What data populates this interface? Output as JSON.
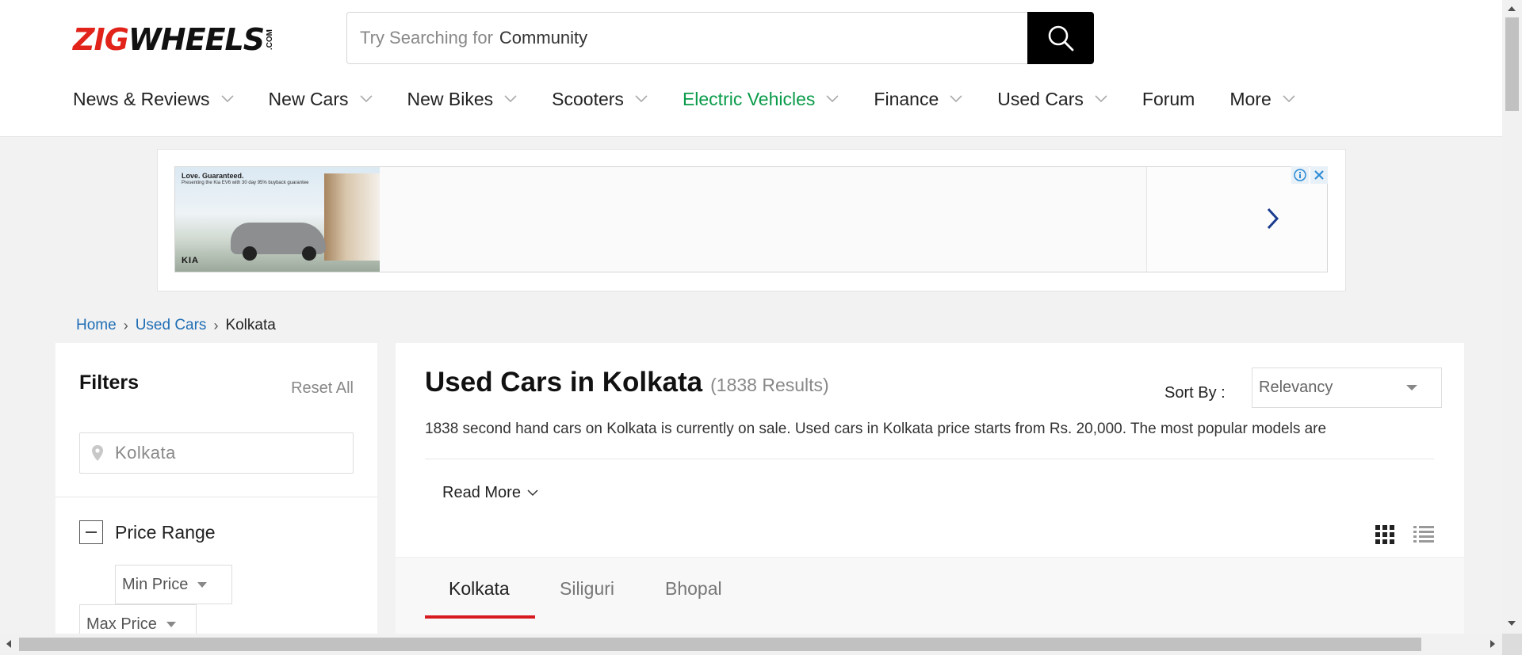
{
  "brand": {
    "logo_part1": "ZIG",
    "logo_part2": "WHEELS",
    "logo_suffix": ".COM",
    "logo_red": "#e2231a"
  },
  "search": {
    "placeholder": "Try Searching for",
    "value": "Community",
    "icon": "search-icon"
  },
  "nav": {
    "items": [
      {
        "label": "News & Reviews",
        "dropdown": true
      },
      {
        "label": "New Cars",
        "dropdown": true
      },
      {
        "label": "New Bikes",
        "dropdown": true
      },
      {
        "label": "Scooters",
        "dropdown": true
      },
      {
        "label": "Electric Vehicles",
        "dropdown": true,
        "color": "#0a9b4a"
      },
      {
        "label": "Finance",
        "dropdown": true
      },
      {
        "label": "Used Cars",
        "dropdown": true
      },
      {
        "label": "Forum",
        "dropdown": false
      },
      {
        "label": "More",
        "dropdown": true
      }
    ]
  },
  "ad": {
    "tagline": "Love. Guaranteed.",
    "subline": "Presenting the Kia EV6 with 30 day 95% buyback guarantee",
    "brand": "KIA",
    "icons": [
      "info-icon",
      "close-icon"
    ]
  },
  "breadcrumb": {
    "items": [
      "Home",
      "Used Cars"
    ],
    "current": "Kolkata"
  },
  "filters": {
    "title": "Filters",
    "reset_label": "Reset All",
    "city_value": "Kolkata",
    "price_range": {
      "title": "Price Range",
      "min_label": "Min Price",
      "max_label": "Max Price"
    }
  },
  "main": {
    "title": "Used Cars in Kolkata",
    "results": "(1838 Results)",
    "sort_label": "Sort By :",
    "sort_value": "Relevancy",
    "description": "1838 second hand cars on Kolkata is currently on sale. Used cars in Kolkata price starts from Rs. 20,000. The most popular models are",
    "read_more": "Read More",
    "tabs": [
      "Kolkata",
      "Siliguri",
      "Bhopal"
    ],
    "active_tab": "Kolkata",
    "accent": "#d71920"
  }
}
